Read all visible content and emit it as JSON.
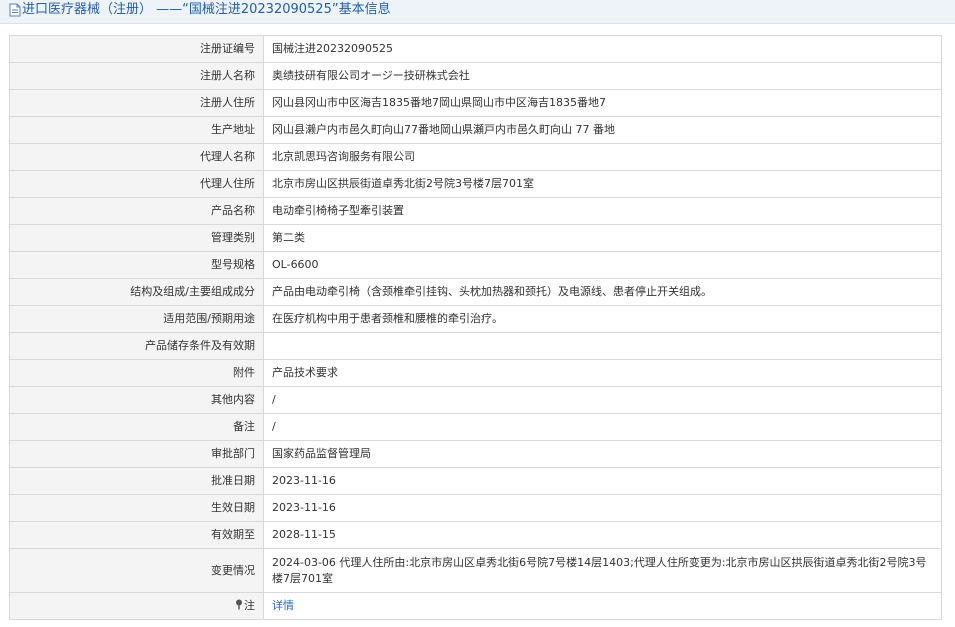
{
  "page": {
    "title": "进口医疗器械（注册） ——“国械注进20232090525”基本信息",
    "icons": {
      "title": "document-icon",
      "note": "pin-icon"
    }
  },
  "rows": [
    {
      "label": "注册证编号",
      "value": "国械注进20232090525"
    },
    {
      "label": "注册人名称",
      "value": "奥绩技研有限公司オージー技研株式会社"
    },
    {
      "label": "注册人住所",
      "value": "冈山县冈山市中区海吉1835番地7岡山県岡山市中区海吉1835番地7"
    },
    {
      "label": "生产地址",
      "value": "冈山县濑户内市邑久町向山77番地岡山県瀬戸内市邑久町向山 77 番地"
    },
    {
      "label": "代理人名称",
      "value": "北京凯思玛咨询服务有限公司"
    },
    {
      "label": "代理人住所",
      "value": "北京市房山区拱辰街道卓秀北街2号院3号楼7层701室"
    },
    {
      "label": "产品名称",
      "value": "电动牵引椅椅子型牽引装置"
    },
    {
      "label": "管理类别",
      "value": "第二类"
    },
    {
      "label": "型号规格",
      "value": "OL-6600"
    },
    {
      "label": "结构及组成/主要组成成分",
      "value": "产品由电动牵引椅（含颈椎牵引挂钩、头枕加热器和颈托）及电源线、患者停止开关组成。"
    },
    {
      "label": "适用范围/预期用途",
      "value": "在医疗机构中用于患者颈椎和腰椎的牵引治疗。"
    },
    {
      "label": "产品储存条件及有效期",
      "value": ""
    },
    {
      "label": "附件",
      "value": "产品技术要求"
    },
    {
      "label": "其他内容",
      "value": "/"
    },
    {
      "label": "备注",
      "value": "/"
    },
    {
      "label": "审批部门",
      "value": "国家药品监督管理局"
    },
    {
      "label": "批准日期",
      "value": "2023-11-16"
    },
    {
      "label": "生效日期",
      "value": "2023-11-16"
    },
    {
      "label": "有效期至",
      "value": "2028-11-15"
    },
    {
      "label": "变更情况",
      "value": "2024-03-06 代理人住所由:北京市房山区卓秀北街6号院7号楼14层1403;代理人住所变更为:北京市房山区拱辰街道卓秀北街2号院3号楼7层701室"
    }
  ],
  "note": {
    "label": "注",
    "link_text": "详情"
  }
}
